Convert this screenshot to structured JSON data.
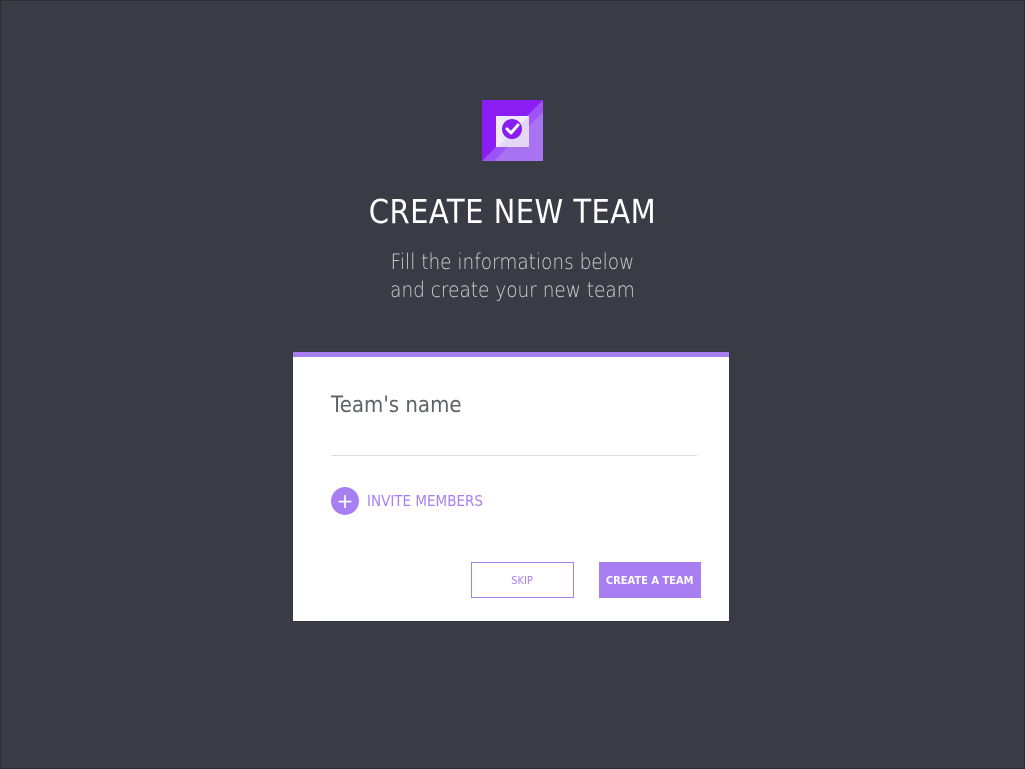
{
  "header": {
    "logo_icon": "check-badge-icon",
    "title": "CREATE NEW TEAM",
    "subtitle_line1": "Fill the informations below",
    "subtitle_line2": "and create your new team"
  },
  "form": {
    "team_name_label": "Team's name",
    "team_name_value": "",
    "invite_icon": "plus-icon",
    "invite_label": "INVITE MEMBERS",
    "skip_label": "SKIP",
    "create_label": "CREATE A TEAM"
  },
  "colors": {
    "background": "#393c45",
    "accent": "#a77ff2",
    "brand_purple": "#8a1ef2",
    "card": "#ffffff"
  }
}
